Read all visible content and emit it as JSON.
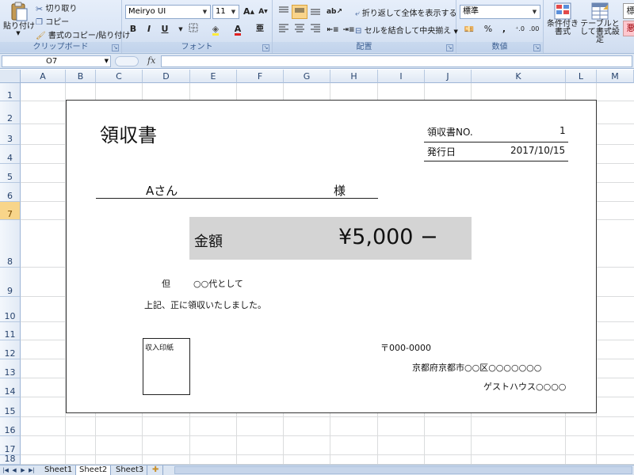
{
  "ribbon": {
    "clipboard": {
      "paste_label": "貼り付け",
      "cut_label": "切り取り",
      "copy_label": "コピー",
      "format_painter_label": "書式のコピー/貼り付け",
      "group_label": "クリップボード"
    },
    "font": {
      "font_name": "Meiryo UI",
      "font_size": "11",
      "group_label": "フォント",
      "bold": "B",
      "italic": "I",
      "underline": "U"
    },
    "alignment": {
      "wrap_text_label": "折り返して全体を表示する",
      "merge_center_label": "セルを結合して中央揃え",
      "group_label": "配置"
    },
    "number": {
      "format_value": "標準",
      "percent": "%",
      "comma": ",",
      "group_label": "数値"
    },
    "styles": {
      "conditional_label": "条件付き書式",
      "table_label": "テーブルとして書式設定",
      "style_partial_1": "標",
      "style_partial_2": "悪"
    }
  },
  "formula_bar": {
    "name_box": "O7",
    "fx": "fx",
    "formula": ""
  },
  "grid": {
    "columns": [
      "A",
      "B",
      "C",
      "D",
      "E",
      "F",
      "G",
      "H",
      "I",
      "J",
      "K",
      "L",
      "M"
    ],
    "rows": [
      "1",
      "2",
      "3",
      "4",
      "5",
      "6",
      "7",
      "8",
      "9",
      "10",
      "11",
      "12",
      "13",
      "14",
      "15",
      "16",
      "17",
      "18"
    ],
    "selected_row": "7"
  },
  "receipt": {
    "title": "領収書",
    "no_label": "領収書NO.",
    "no_value": "1",
    "date_label": "発行日",
    "date_value": "2017/10/15",
    "recipient": "Aさん",
    "honorific": "様",
    "amount_label": "金額",
    "amount_value": "¥5,000 −",
    "tadashi_label": "但",
    "tadashi_value": "○○代として",
    "note": "上記、正に領収いたしました。",
    "stamp_label": "収入印紙",
    "zip": "〒000-0000",
    "address": "京都府京都市○○区○○○○○○○",
    "company": "ゲストハウス○○○○"
  },
  "sheets": [
    "Sheet1",
    "Sheet2",
    "Sheet3"
  ],
  "active_sheet": "Sheet2"
}
